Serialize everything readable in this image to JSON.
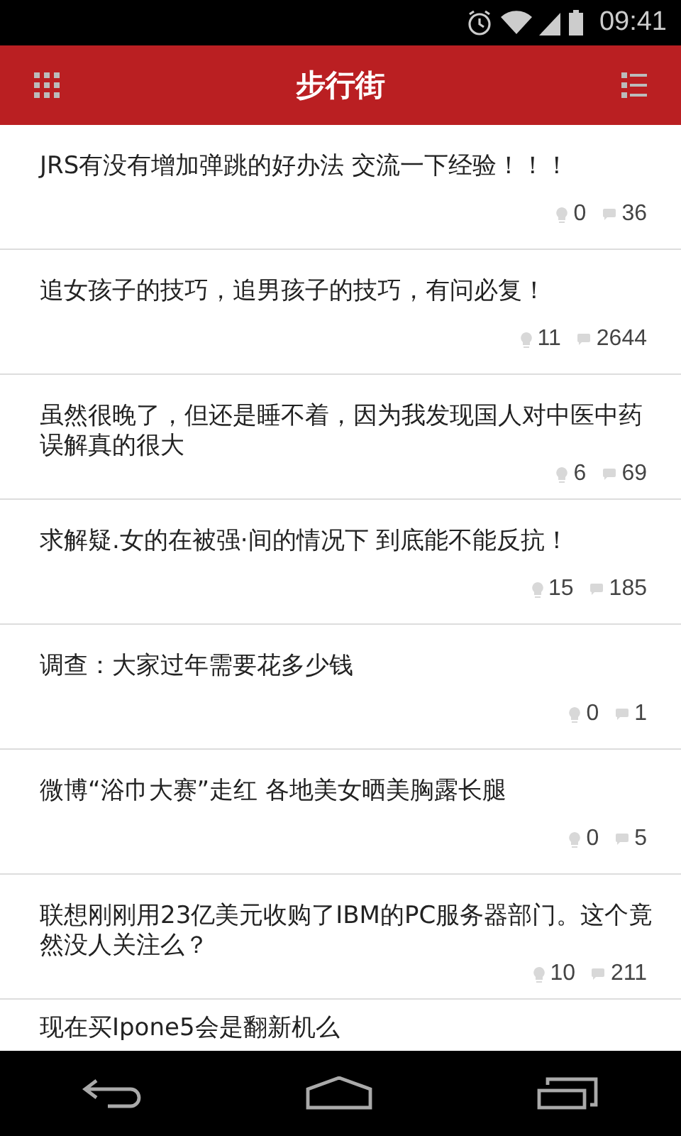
{
  "status_bar": {
    "time": "09:41"
  },
  "header": {
    "title": "步行街"
  },
  "posts": [
    {
      "title": "JRS有没有增加弹跳的好办法 交流一下经验！！！",
      "lights": "0",
      "replies": "36"
    },
    {
      "title": "追女孩子的技巧，追男孩子的技巧，有问必复！",
      "lights": "11",
      "replies": "2644"
    },
    {
      "title": "虽然很晚了，但还是睡不着，因为我发现国人对中医中药误解真的很大",
      "lights": "6",
      "replies": "69"
    },
    {
      "title": "求解疑.女的在被强·间的情况下 到底能不能反抗！",
      "lights": "15",
      "replies": "185"
    },
    {
      "title": "调查：大家过年需要花多少钱",
      "lights": "0",
      "replies": "1"
    },
    {
      "title": "微博“浴巾大赛”走红 各地美女晒美胸露长腿",
      "lights": "0",
      "replies": "5"
    },
    {
      "title": "联想刚刚用23亿美元收购了IBM的PC服务器部门。这个竟然没人关注么？",
      "lights": "10",
      "replies": "211"
    },
    {
      "title": "现在买Ipone5会是翻新机么"
    }
  ]
}
